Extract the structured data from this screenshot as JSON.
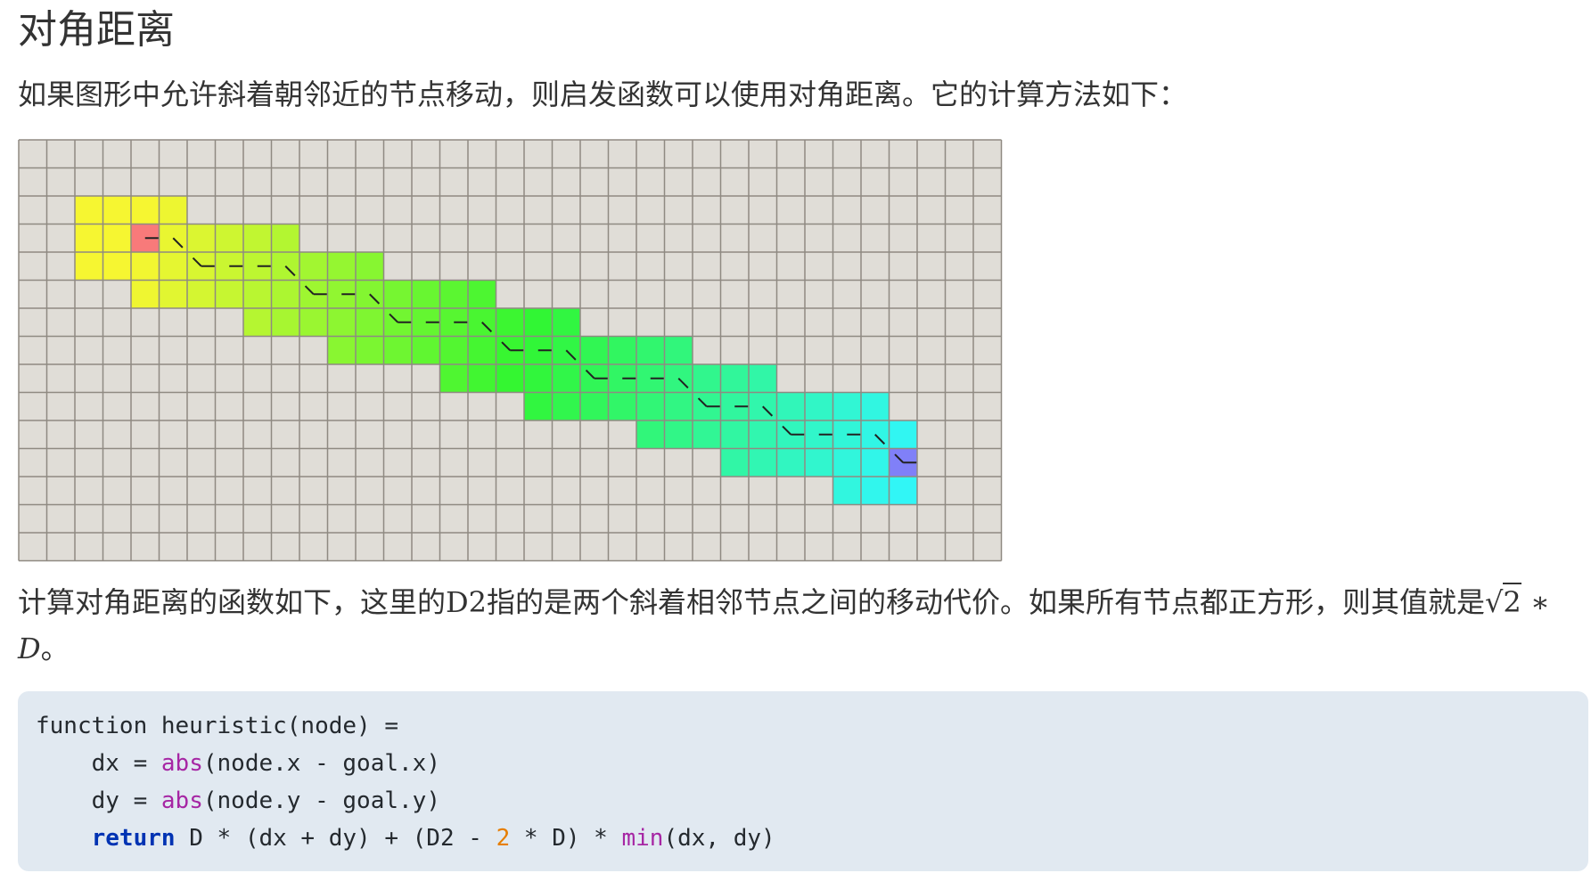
{
  "heading": "对角距离",
  "intro": "如果图形中允许斜着朝邻近的节点移动，则启发函数可以使用对角距离。它的计算方法如下：",
  "grid": {
    "cols": 35,
    "rows": 15,
    "background": "#e0ddd7",
    "line_color": "#8f8a82",
    "start": [
      4,
      3
    ],
    "goal": [
      31,
      11
    ],
    "start_color": "#f87a7a",
    "goal_color": "#8080f8"
  },
  "description": {
    "text": "计算对角距离的函数如下，这里的D2指的是两个斜着相邻节点之间的移动代价。如果所有节点都正方形，则其值就是",
    "formula_radical": "√",
    "formula_radicand": "2",
    "formula_operator": " ∗ ",
    "formula_var": "D",
    "end_mark": "。"
  },
  "code": {
    "line1": "function heuristic(node) =",
    "line2_indent": "    ",
    "line2_a": "dx = ",
    "line2_fn": "abs",
    "line2_b": "(node.x - goal.x)",
    "line3_indent": "    ",
    "line3_a": "dy = ",
    "line3_fn": "abs",
    "line3_b": "(node.y - goal.y)",
    "line4_indent": "    ",
    "line4_kw": "return",
    "line4_a": " D * (dx + dy) + (D2 - ",
    "line4_num": "2",
    "line4_b": " * D) * ",
    "line4_fn": "min",
    "line4_c": "(dx, dy)"
  }
}
